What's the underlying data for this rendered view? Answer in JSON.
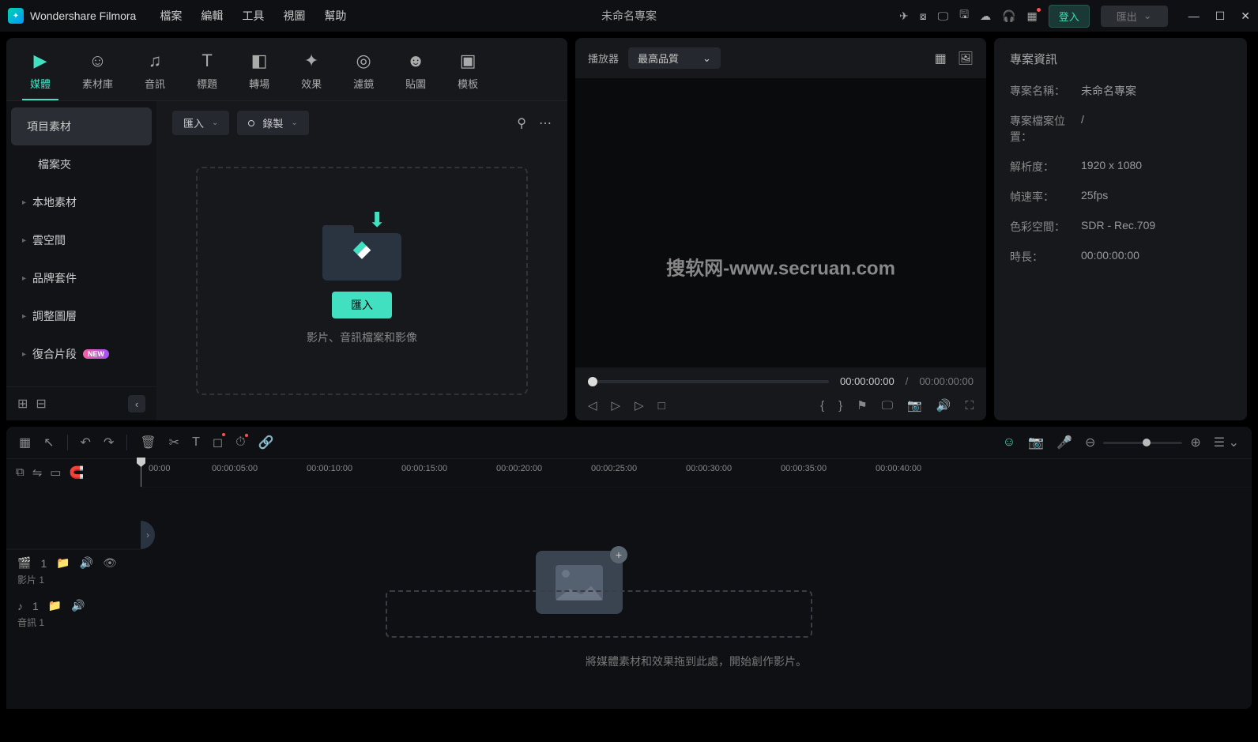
{
  "titlebar": {
    "app_name": "Wondershare Filmora",
    "menu": [
      "檔案",
      "編輯",
      "工具",
      "視圖",
      "幫助"
    ],
    "project_title": "未命名專案",
    "login": "登入",
    "export": "匯出"
  },
  "tabs": [
    {
      "icon": "▶",
      "label": "媒體"
    },
    {
      "icon": "☺",
      "label": "素材庫"
    },
    {
      "icon": "♫",
      "label": "音訊"
    },
    {
      "icon": "T",
      "label": "標題"
    },
    {
      "icon": "◧",
      "label": "轉場"
    },
    {
      "icon": "✦",
      "label": "效果"
    },
    {
      "icon": "◎",
      "label": "濾鏡"
    },
    {
      "icon": "☻",
      "label": "貼圖"
    },
    {
      "icon": "▣",
      "label": "模板"
    }
  ],
  "sidebar": {
    "items": [
      {
        "label": "項目素材",
        "active": true,
        "arrow": false
      },
      {
        "label": "檔案夾",
        "arrow": false,
        "indent": true
      },
      {
        "label": "本地素材",
        "arrow": true
      },
      {
        "label": "雲空間",
        "arrow": true
      },
      {
        "label": "品牌套件",
        "arrow": true
      },
      {
        "label": "調整圖層",
        "arrow": true
      },
      {
        "label": "復合片段",
        "arrow": true,
        "badge": "NEW"
      }
    ]
  },
  "content": {
    "import_dd": "匯入",
    "record_dd": "錄製",
    "import_btn": "匯入",
    "dropzone_text": "影片、音訊檔案和影像"
  },
  "preview": {
    "player_label": "播放器",
    "quality_dd": "最高品質",
    "watermark": "搜软网-www.secruan.com",
    "time_current": "00:00:00:00",
    "time_sep": "/",
    "time_total": "00:00:00:00"
  },
  "info": {
    "title": "專案資訊",
    "rows": [
      {
        "label": "專案名稱：",
        "value": "未命名專案"
      },
      {
        "label": "專案檔案位置：",
        "value": "/"
      },
      {
        "label": "解析度：",
        "value": "1920 x 1080"
      },
      {
        "label": "幀速率：",
        "value": "25fps"
      },
      {
        "label": "色彩空間：",
        "value": "SDR - Rec.709"
      },
      {
        "label": "時長：",
        "value": "00:00:00:00"
      }
    ]
  },
  "timeline": {
    "ruler": [
      "00:00",
      "00:00:05:00",
      "00:00:10:00",
      "00:00:15:00",
      "00:00:20:00",
      "00:00:25:00",
      "00:00:30:00",
      "00:00:35:00",
      "00:00:40:00"
    ],
    "video_track": {
      "badge": "1",
      "name": "影片 1"
    },
    "audio_track": {
      "badge": "1",
      "name": "音訊 1"
    },
    "drop_hint": "將媒體素材和效果拖到此處，開始創作影片。"
  }
}
